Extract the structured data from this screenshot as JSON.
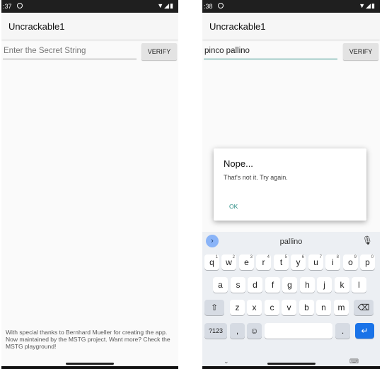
{
  "left": {
    "status_time": ":37",
    "app_title": "Uncrackable1",
    "input_placeholder": "Enter the Secret String",
    "verify_label": "VERIFY",
    "footer_text": "With special thanks to Bernhard Mueller for creating the app. Now maintained by the MSTG project. Want more? Check the MSTG playground!"
  },
  "right": {
    "status_time": ":38",
    "app_title": "Uncrackable1",
    "input_value": "pinco pallino",
    "verify_label": "VERIFY",
    "dialog": {
      "title": "Nope...",
      "message": "That's not it. Try again.",
      "ok_label": "OK"
    },
    "keyboard": {
      "suggestion": "pallino",
      "row1": [
        "q",
        "w",
        "e",
        "r",
        "t",
        "y",
        "u",
        "i",
        "o",
        "p"
      ],
      "row1_hints": [
        "1",
        "2",
        "3",
        "4",
        "5",
        "6",
        "7",
        "8",
        "9",
        "0"
      ],
      "row2": [
        "a",
        "s",
        "d",
        "f",
        "g",
        "h",
        "j",
        "k",
        "l"
      ],
      "row3": [
        "z",
        "x",
        "c",
        "v",
        "b",
        "n",
        "m"
      ],
      "symbols_label": "?123",
      "comma": ",",
      "period": "."
    }
  },
  "icons": [
    "wifi-icon",
    "signal-icon",
    "battery-icon",
    "mic-icon",
    "emoji-icon",
    "shift-icon",
    "backspace-icon",
    "enter-icon",
    "chevron-right-icon",
    "keyboard-hide-icon",
    "nav-down-icon"
  ]
}
